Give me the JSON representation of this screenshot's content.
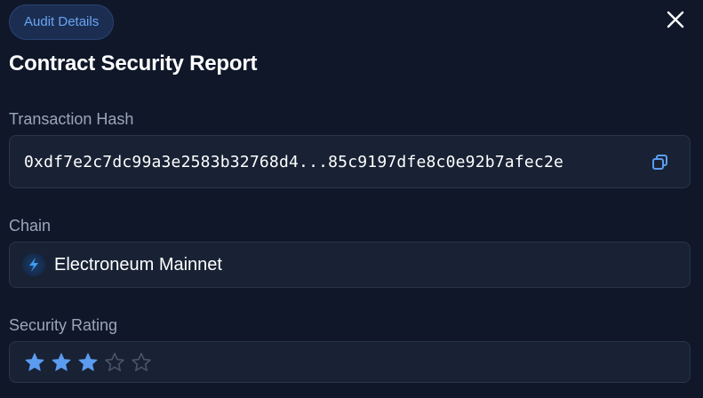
{
  "badge": {
    "label": "Audit Details"
  },
  "header": {
    "title": "Contract Security Report"
  },
  "transaction": {
    "label": "Transaction Hash",
    "hash": "0xdf7e2c7dc99a3e2583b32768d4...85c9197dfe8c0e92b7afec2e"
  },
  "chain": {
    "label": "Chain",
    "name": "Electroneum Mainnet",
    "icon": "lightning-bolt-icon"
  },
  "security": {
    "label": "Security Rating",
    "rating": 3,
    "max_rating": 5
  },
  "colors": {
    "background": "#0f1729",
    "field_bg": "#182234",
    "accent": "#69a5f2",
    "star_filled": "#5b9cf0",
    "star_empty": "#4a5568"
  },
  "icons": {
    "close": "close-icon",
    "copy": "copy-icon"
  }
}
